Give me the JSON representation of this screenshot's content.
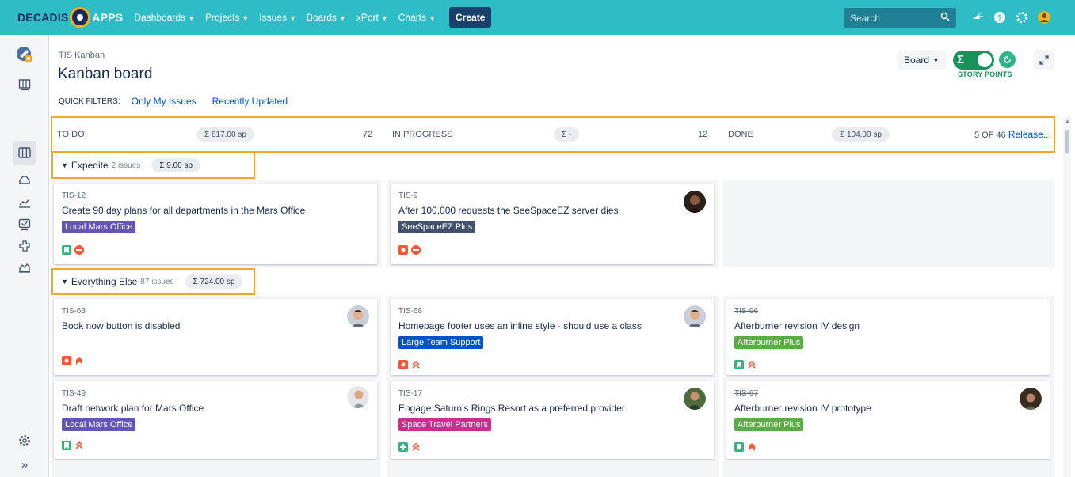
{
  "topbar": {
    "logo_left": "DECADIS",
    "logo_right": "APPS",
    "nav": [
      {
        "label": "Dashboards"
      },
      {
        "label": "Projects"
      },
      {
        "label": "Issues"
      },
      {
        "label": "Boards"
      },
      {
        "label": "xPort"
      },
      {
        "label": "Charts"
      }
    ],
    "create_label": "Create",
    "search_placeholder": "Search",
    "bg_color": "#2ebcc7"
  },
  "sidebar": {
    "top_icons": [
      "project-avatar-icon",
      "backlog-icon",
      "board-icon",
      "releases-icon",
      "reports-icon",
      "issues-icon",
      "components-icon",
      "charts-icon"
    ],
    "bottom_icons": [
      "settings-icon",
      "expand-sidebar-icon"
    ]
  },
  "header": {
    "project_name": "TIS Kanban",
    "title": "Kanban board",
    "quick_filters_label": "QUICK FILTERS:",
    "quick_filters": [
      "Only My Issues",
      "Recently Updated"
    ],
    "board_menu_label": "Board",
    "story_points_label": "STORY POINTS"
  },
  "columns": [
    {
      "title": "TO DO",
      "sum": "Σ 617.00 sp",
      "count": "72"
    },
    {
      "title": "IN PROGRESS",
      "sum": "Σ -",
      "count": "12"
    },
    {
      "title": "DONE",
      "sum": "Σ 104.00 sp",
      "count": "5 OF 46",
      "release": "Release..."
    }
  ],
  "swimlanes": [
    {
      "name": "Expedite",
      "count": "2 issues",
      "sum": "Σ 9.00 sp",
      "cards": [
        {
          "key": "TIS-12",
          "summary": "Create 90 day plans for all departments in the Mars Office",
          "epic": "Local Mars Office",
          "epic_color": "#6554c0",
          "type_icon": "story-icon",
          "priority_icon": "blocker-icon",
          "avatar": null,
          "done": false
        },
        {
          "key": "TIS-9",
          "summary": "After 100,000 requests the SeeSpaceEZ server dies",
          "epic": "SeeSpaceEZ Plus",
          "epic_color": "#42526e",
          "type_icon": "bug-icon",
          "priority_icon": "blocker-icon",
          "avatar": "user-avatar",
          "done": false
        }
      ]
    },
    {
      "name": "Everything Else",
      "count": "87 issues",
      "sum": "Σ 724.00 sp",
      "cards": [
        {
          "key": "TIS-63",
          "summary": "Book now button is disabled",
          "epic": null,
          "type_icon": "bug-icon",
          "priority_icon": "highest-priority-icon",
          "avatar": "user-avatar",
          "done": false
        },
        {
          "key": "TIS-68",
          "summary": "Homepage footer uses an inline style - should use a class",
          "epic": "Large Team Support",
          "epic_color": "#0052cc",
          "type_icon": "bug-icon",
          "priority_icon": "high-priority-icon",
          "avatar": "user-avatar",
          "done": false
        },
        {
          "key": "TIS-96",
          "summary": "Afterburner revision IV design",
          "epic": "Afterburner Plus",
          "epic_color": "#5aac44",
          "type_icon": "story-icon",
          "priority_icon": "high-priority-icon",
          "avatar": null,
          "done": true
        },
        {
          "key": "TIS-49",
          "summary": "Draft network plan for Mars Office",
          "epic": "Local Mars Office",
          "epic_color": "#6554c0",
          "type_icon": "story-icon",
          "priority_icon": "high-priority-icon",
          "avatar": "user-avatar",
          "done": false
        },
        {
          "key": "TIS-17",
          "summary": "Engage Saturn's Rings Resort as a preferred provider",
          "epic": "Space Travel Partners",
          "epic_color": "#cd2d8f",
          "type_icon": "new-feature-icon",
          "priority_icon": "high-priority-icon",
          "avatar": "user-avatar",
          "done": false
        },
        {
          "key": "TIS-97",
          "summary": "Afterburner revision IV prototype",
          "epic": "Afterburner Plus",
          "epic_color": "#5aac44",
          "type_icon": "story-icon",
          "priority_icon": "highest-priority-icon",
          "avatar": "user-avatar",
          "done": true
        }
      ]
    }
  ]
}
